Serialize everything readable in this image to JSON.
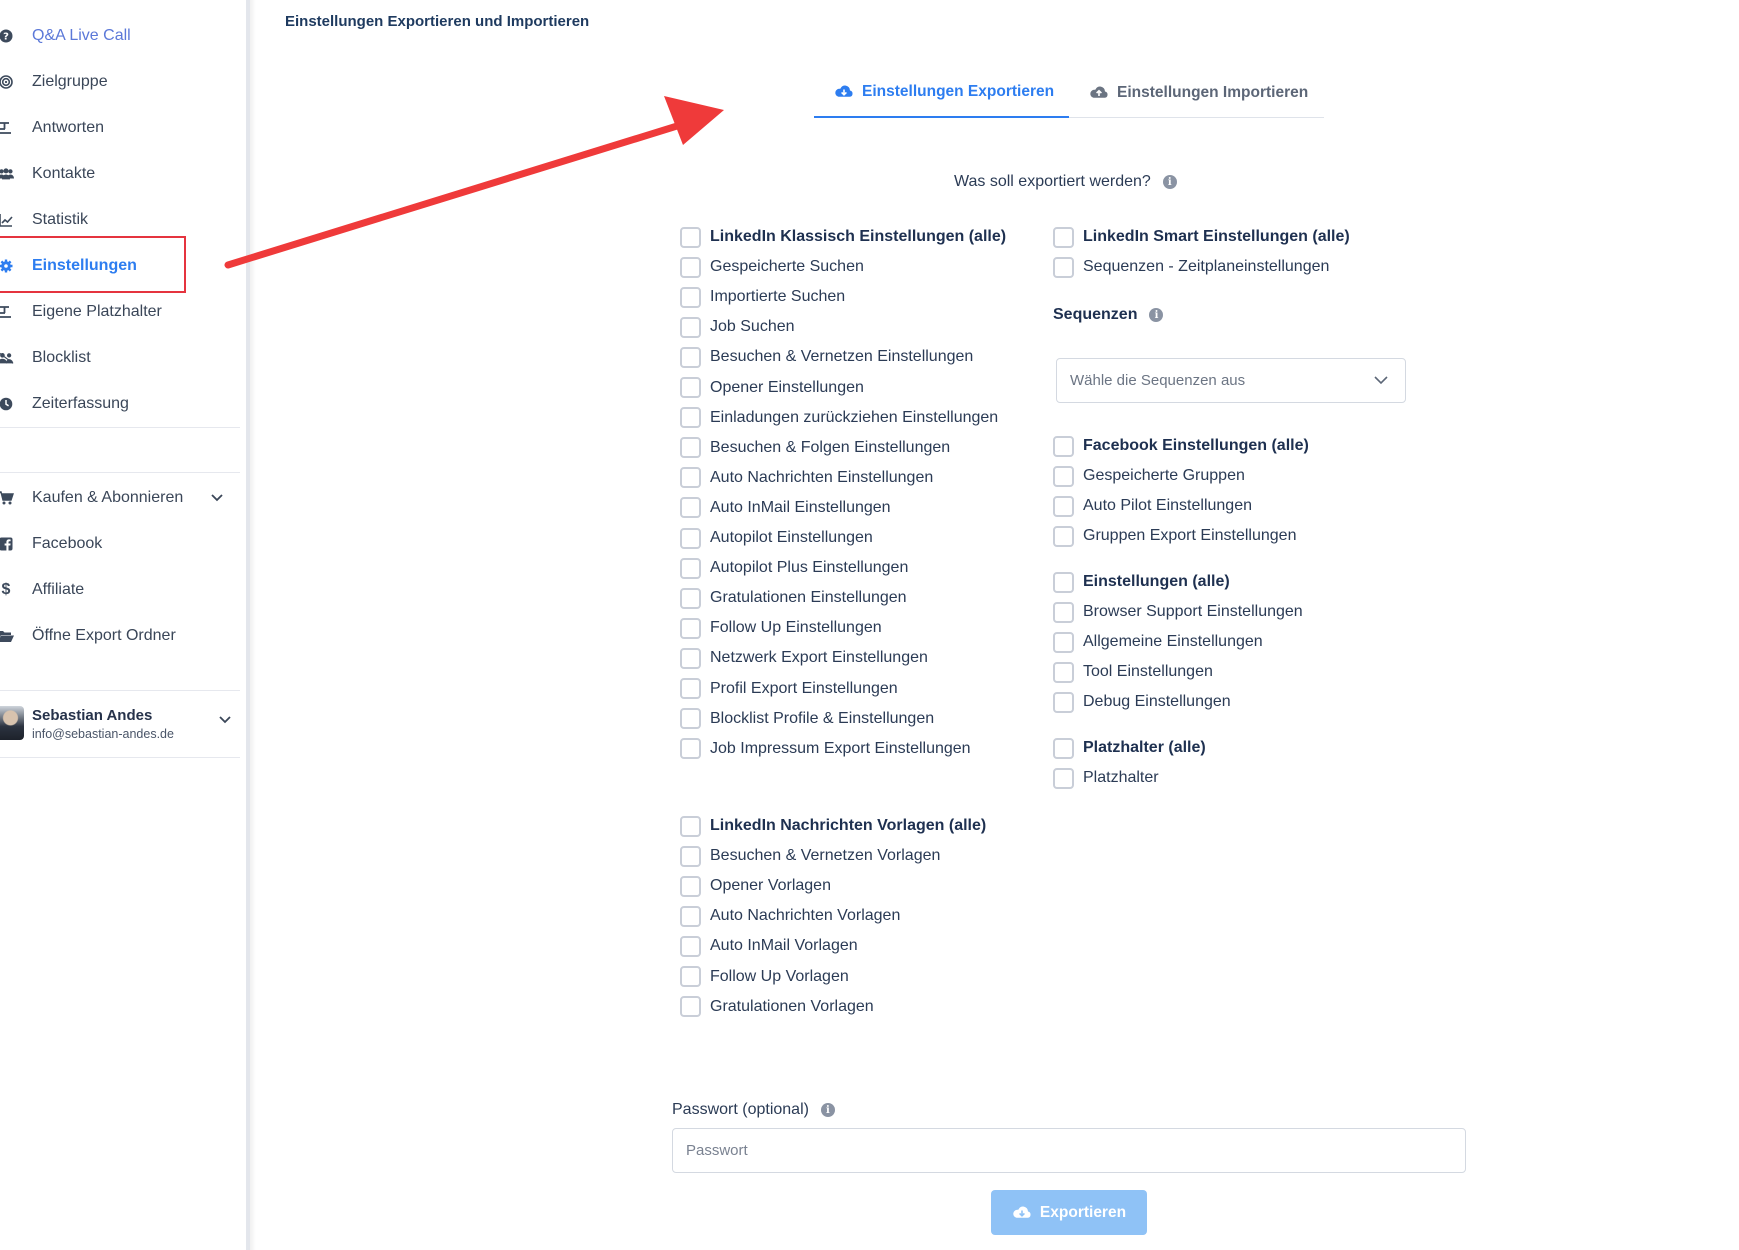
{
  "sidebar": {
    "items": [
      {
        "label": "Q&A Live Call",
        "icon": "question-circle-icon"
      },
      {
        "label": "Zielgruppe",
        "icon": "target-icon"
      },
      {
        "label": "Antworten",
        "icon": "text-format-icon"
      },
      {
        "label": "Kontakte",
        "icon": "users-icon"
      },
      {
        "label": "Statistik",
        "icon": "line-chart-icon"
      },
      {
        "label": "Einstellungen",
        "icon": "gear-icon"
      },
      {
        "label": "Eigene Platzhalter",
        "icon": "text-format-icon"
      },
      {
        "label": "Blocklist",
        "icon": "user-block-icon"
      },
      {
        "label": "Zeiterfassung",
        "icon": "clock-icon"
      },
      {
        "label": "Kaufen & Abonnieren",
        "icon": "cart-icon"
      },
      {
        "label": "Facebook",
        "icon": "facebook-icon"
      },
      {
        "label": "Affiliate",
        "icon": "dollar-icon"
      },
      {
        "label": "Öffne Export Ordner",
        "icon": "folder-open-icon"
      }
    ],
    "user": {
      "name": "Sebastian Andes",
      "email": "info@sebastian-andes.de"
    }
  },
  "page": {
    "title": "Einstellungen Exportieren und Importieren"
  },
  "tabs": {
    "export": "Einstellungen Exportieren",
    "import": "Einstellungen Importieren"
  },
  "question": "Was soll exportiert werden?",
  "left_column": {
    "group1": [
      "LinkedIn Klassisch Einstellungen (alle)",
      "Gespeicherte Suchen",
      "Importierte Suchen",
      "Job Suchen",
      "Besuchen & Vernetzen Einstellungen",
      "Opener Einstellungen",
      "Einladungen zurückziehen Einstellungen",
      "Besuchen & Folgen Einstellungen",
      "Auto Nachrichten Einstellungen",
      "Auto InMail Einstellungen",
      "Autopilot Einstellungen",
      "Autopilot Plus Einstellungen",
      "Gratulationen Einstellungen",
      "Follow Up Einstellungen",
      "Netzwerk Export Einstellungen",
      "Profil Export Einstellungen",
      "Blocklist Profile & Einstellungen",
      "Job Impressum Export Einstellungen"
    ],
    "group2": [
      "LinkedIn Nachrichten Vorlagen (alle)",
      "Besuchen & Vernetzen Vorlagen",
      "Opener Vorlagen",
      "Auto Nachrichten Vorlagen",
      "Auto InMail Vorlagen",
      "Follow Up Vorlagen",
      "Gratulationen Vorlagen"
    ]
  },
  "right_column": {
    "smart": [
      "LinkedIn Smart Einstellungen (alle)",
      "Sequenzen - Zeitplaneinstellungen"
    ],
    "sequences_label": "Sequenzen",
    "sequences_placeholder": "Wähle die Sequenzen aus",
    "facebook": [
      "Facebook Einstellungen (alle)",
      "Gespeicherte Gruppen",
      "Auto Pilot Einstellungen",
      "Gruppen Export Einstellungen"
    ],
    "general": [
      "Einstellungen (alle)",
      "Browser Support Einstellungen",
      "Allgemeine Einstellungen",
      "Tool Einstellungen",
      "Debug Einstellungen"
    ],
    "placeholders": [
      "Platzhalter (alle)",
      "Platzhalter"
    ]
  },
  "password": {
    "label": "Passwort (optional)",
    "placeholder": "Passwort"
  },
  "export_button": "Exportieren",
  "colors": {
    "accent": "#2d7df0",
    "highlight": "#e5343f",
    "arrow": "#ef3a3a",
    "button": "#8fc2f6"
  }
}
